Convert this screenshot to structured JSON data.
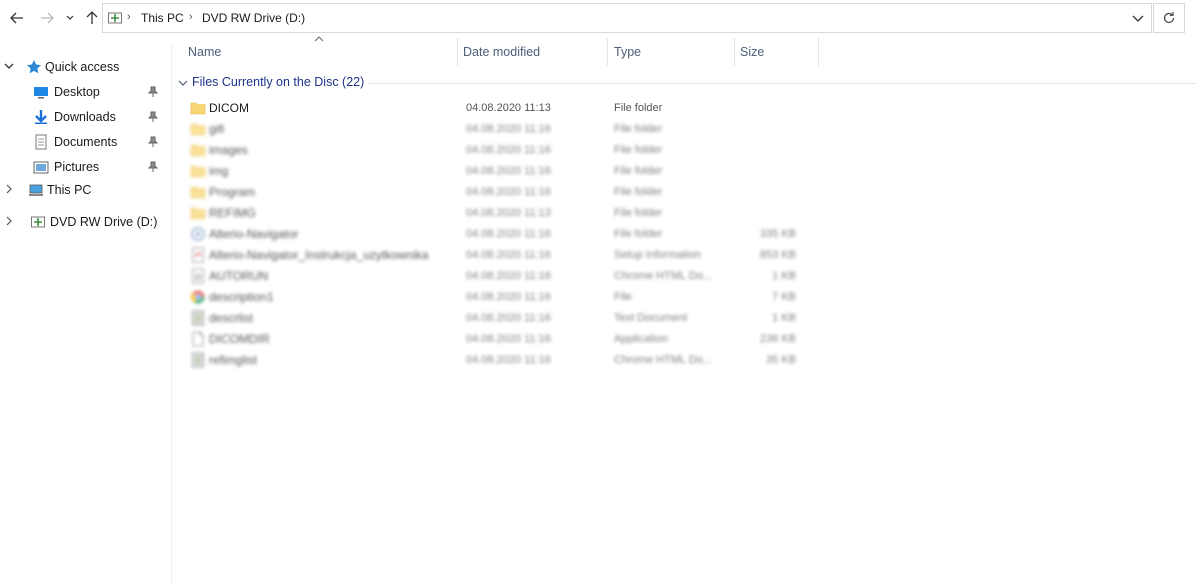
{
  "address_bar": {
    "breadcrumbs": [
      "This PC",
      "DVD RW Drive (D:)"
    ]
  },
  "nav_pane": {
    "quick_access": {
      "label": "Quick access"
    },
    "items": [
      {
        "label": "Desktop",
        "icon": "desktop-icon",
        "pinned": true
      },
      {
        "label": "Downloads",
        "icon": "downloads-icon",
        "pinned": true
      },
      {
        "label": "Documents",
        "icon": "documents-icon",
        "pinned": true
      },
      {
        "label": "Pictures",
        "icon": "pictures-icon",
        "pinned": true
      }
    ],
    "this_pc": {
      "label": "This PC"
    },
    "dvd_drive": {
      "label": "DVD RW Drive (D:)"
    }
  },
  "columns": {
    "name": "Name",
    "date_modified": "Date modified",
    "type": "Type",
    "size": "Size"
  },
  "group": {
    "label": "Files Currently on the Disc (22)"
  },
  "files": [
    {
      "name": "DICOM",
      "date": "04.08.2020 11:13",
      "type": "File folder",
      "size": "",
      "icon": "folder-icon",
      "blurred": false
    },
    {
      "name": "gifi",
      "date": "04.08.2020 11:16",
      "type": "File folder",
      "size": "",
      "icon": "folder-icon",
      "blurred": true
    },
    {
      "name": "images",
      "date": "04.08.2020 11:16",
      "type": "File folder",
      "size": "",
      "icon": "folder-icon",
      "blurred": true
    },
    {
      "name": "img",
      "date": "04.08.2020 11:16",
      "type": "File folder",
      "size": "",
      "icon": "folder-icon",
      "blurred": true
    },
    {
      "name": "Program",
      "date": "04.08.2020 11:16",
      "type": "File folder",
      "size": "",
      "icon": "folder-icon",
      "blurred": true
    },
    {
      "name": "REFIMG",
      "date": "04.08.2020 11:13",
      "type": "File folder",
      "size": "",
      "icon": "folder-icon",
      "blurred": true
    },
    {
      "name": "Alterio-Navigator",
      "date": "04.08.2020 11:16",
      "type": "File folder",
      "size": "335 KB",
      "icon": "app-icon",
      "blurred": true
    },
    {
      "name": "Alterio-Navigator_Instrukcja_uzytkownika",
      "date": "04.08.2020 11:16",
      "type": "Setup Information",
      "size": "853 KB",
      "icon": "pdf-icon",
      "blurred": true
    },
    {
      "name": "AUTORUN",
      "date": "04.08.2020 11:16",
      "type": "Chrome HTML Do...",
      "size": "1 KB",
      "icon": "settings-file-icon",
      "blurred": true
    },
    {
      "name": "description1",
      "date": "04.08.2020 11:16",
      "type": "File",
      "size": "7 KB",
      "icon": "chrome-icon",
      "blurred": true
    },
    {
      "name": "descrlist",
      "date": "04.08.2020 11:16",
      "type": "Text Document",
      "size": "1 KB",
      "icon": "notepad-icon",
      "blurred": true
    },
    {
      "name": "DICOMDIR",
      "date": "04.08.2020 11:16",
      "type": "Application",
      "size": "236 KB",
      "icon": "blank-file-icon",
      "blurred": true
    },
    {
      "name": "refimglist",
      "date": "04.08.2020 11:16",
      "type": "Chrome HTML Do...",
      "size": "35 KB",
      "icon": "notepad-icon",
      "blurred": true
    }
  ],
  "colors": {
    "accent": "#0078d7",
    "folder": "#f8d775",
    "group_label": "#1e3287",
    "column_header": "#4c607a"
  }
}
